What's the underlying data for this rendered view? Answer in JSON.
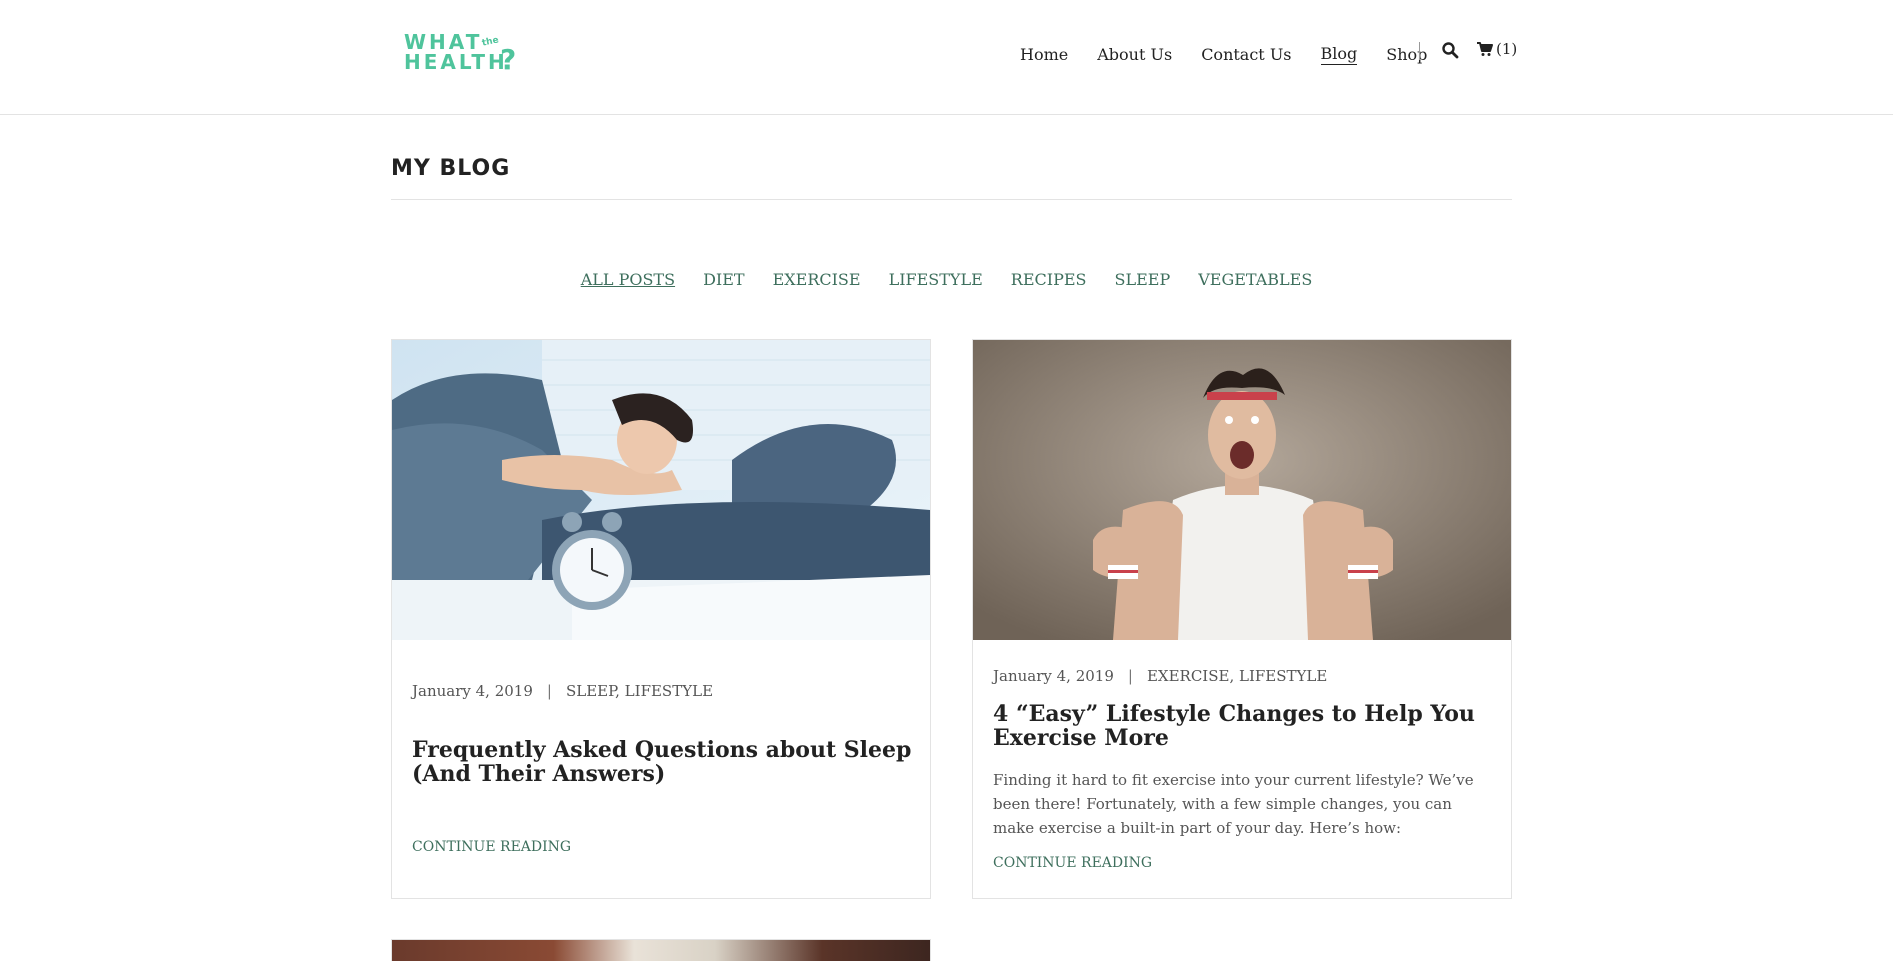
{
  "brand": {
    "line1": "WHAT",
    "small": "the",
    "line2": "HEALTH",
    "mark": "?",
    "color": "#4fc49c"
  },
  "nav": {
    "items": [
      {
        "label": "Home",
        "active": false
      },
      {
        "label": "About Us",
        "active": false
      },
      {
        "label": "Contact Us",
        "active": false
      },
      {
        "label": "Blog",
        "active": true
      },
      {
        "label": "Shop",
        "active": false
      }
    ],
    "search_icon": "search-icon",
    "cart_icon": "cart-icon",
    "cart_count": "(1)"
  },
  "page": {
    "title": "MY BLOG"
  },
  "categories": {
    "items": [
      "ALL POSTS",
      "DIET",
      "EXERCISE",
      "LIFESTYLE",
      "RECIPES",
      "SLEEP",
      "VEGETABLES"
    ],
    "active": "ALL POSTS",
    "link_color": "#3e6f5d"
  },
  "posts": [
    {
      "date": "January 4, 2019",
      "categories": "SLEEP, LIFESTYLE",
      "title": "Frequently Asked Questions about Sleep (And Their Answers)",
      "excerpt": "",
      "cta": "CONTINUE READING",
      "image": "woman-in-bed-with-alarm-clock"
    },
    {
      "date": "January 4, 2019",
      "categories": "EXERCISE, LIFESTYLE",
      "title": "4 “Easy” Lifestyle Changes to Help You Exercise More",
      "excerpt": "Finding it hard to fit exercise into your current lifestyle? We’ve been there! Fortunately, with a few simple changes, you can make exercise a built-in part of your day. Here’s how:",
      "cta": "CONTINUE READING",
      "image": "excited-man-thumbs-up-headband"
    }
  ],
  "separator": "|"
}
